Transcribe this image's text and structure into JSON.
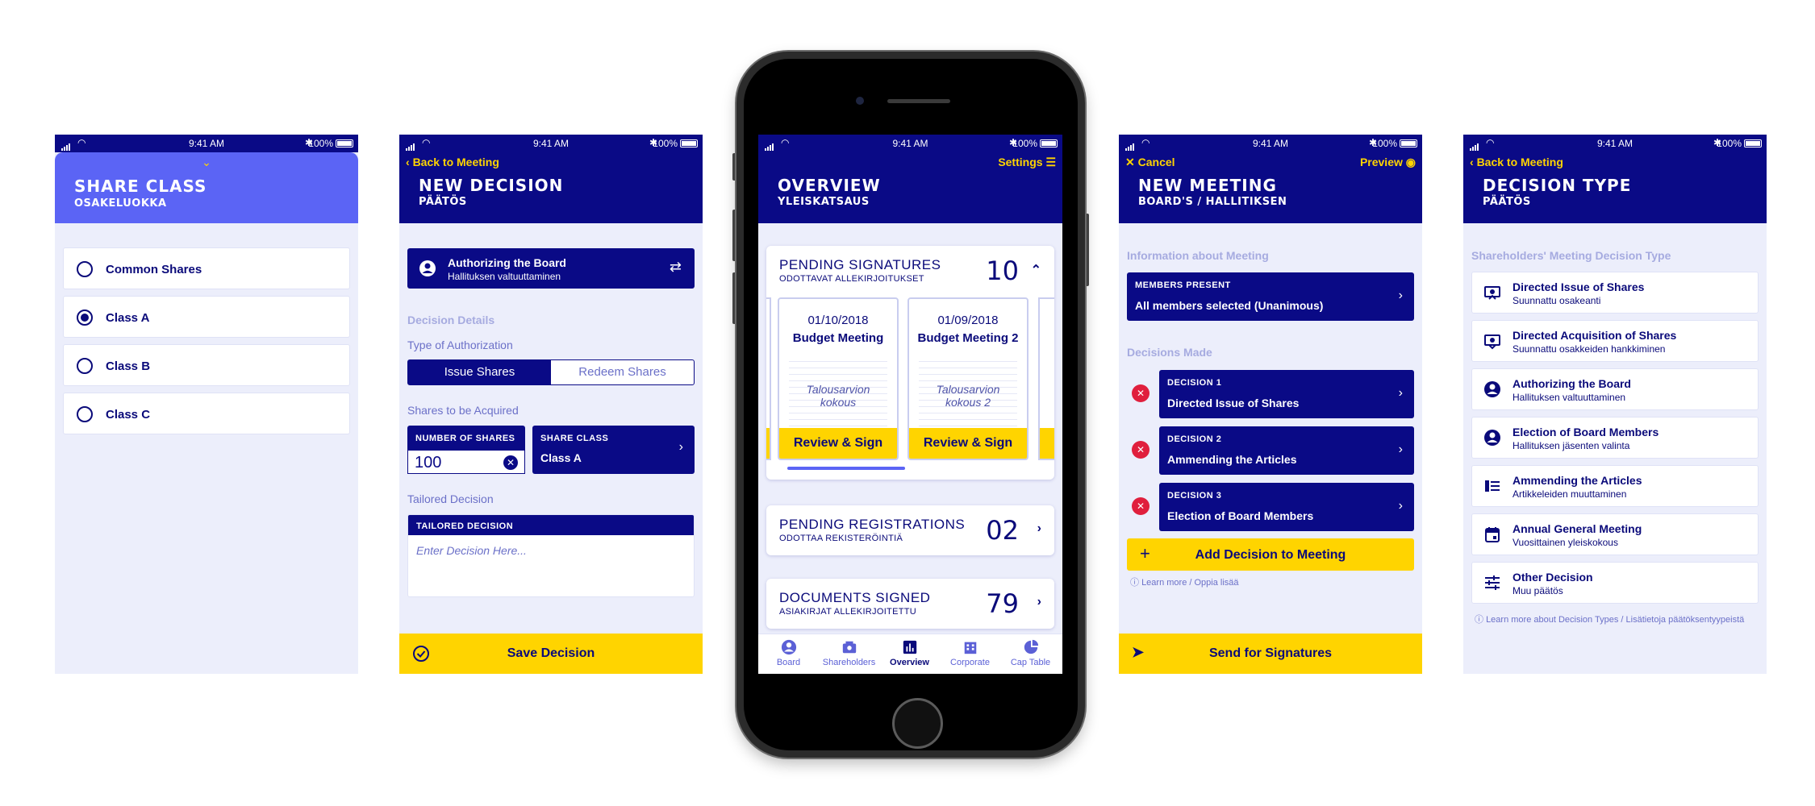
{
  "status": {
    "time": "9:41 AM",
    "battery": "100%"
  },
  "share_class": {
    "title": "SHARE CLASS",
    "subtitle": "OSAKELUOKKA",
    "options": [
      {
        "label": "Common Shares",
        "selected": false
      },
      {
        "label": "Class A",
        "selected": true
      },
      {
        "label": "Class B",
        "selected": false
      },
      {
        "label": "Class C",
        "selected": false
      }
    ]
  },
  "new_decision": {
    "back": "Back to Meeting",
    "title": "NEW DECISION",
    "subtitle": "PÄÄTÖS",
    "auth_title": "Authorizing the Board",
    "auth_sub": "Hallituksen valtuuttaminen",
    "details_label": "Decision Details",
    "type_label": "Type of Authorization",
    "seg_issue": "Issue Shares",
    "seg_redeem": "Redeem Shares",
    "acquired_label": "Shares to be Acquired",
    "num_label": "NUMBER OF SHARES",
    "num_value": "100",
    "class_label": "SHARE CLASS",
    "class_value": "Class A",
    "tailored_label": "Tailored Decision",
    "tailored_box_label": "TAILORED DECISION",
    "tailored_placeholder": "Enter Decision Here...",
    "save": "Save Decision"
  },
  "overview": {
    "settings": "Settings",
    "title": "OVERVIEW",
    "subtitle": "YLEISKATSAUS",
    "pending_sig_title": "PENDING SIGNATURES",
    "pending_sig_sub": "ODOTTAVAT ALLEKIRJOITUKSET",
    "pending_sig_count": "10",
    "meetings": [
      {
        "date": "01/10/2018",
        "name": "Budget Meeting",
        "doc1": "Talousarvion",
        "doc2": "kokous",
        "action": "Review & Sign"
      },
      {
        "date": "01/09/2018",
        "name": "Budget Meeting 2",
        "doc1": "Talousarvion",
        "doc2": "kokous 2",
        "action": "Review & Sign"
      }
    ],
    "pending_reg_title": "PENDING REGISTRATIONS",
    "pending_reg_sub": "ODOTTAA REKISTERÖINTIÄ",
    "pending_reg_count": "02",
    "docs_title": "DOCUMENTS SIGNED",
    "docs_sub": "ASIAKIRJAT ALLEKIRJOITETTU",
    "docs_count": "79",
    "tabs": [
      "Board",
      "Shareholders",
      "Overview",
      "Corporate",
      "Cap Table"
    ]
  },
  "new_meeting": {
    "cancel": "Cancel",
    "preview": "Preview",
    "title": "NEW MEETING",
    "subtitle": "BOARD'S / HALLITIKSEN",
    "info_label": "Information about Meeting",
    "members_label": "MEMBERS PRESENT",
    "members_value": "All members selected (Unanimous)",
    "decisions_label": "Decisions Made",
    "decisions": [
      {
        "label": "DECISION 1",
        "value": "Directed Issue of Shares"
      },
      {
        "label": "DECISION 2",
        "value": "Ammending the Articles"
      },
      {
        "label": "DECISION 3",
        "value": "Election of Board Members"
      }
    ],
    "add": "Add Decision to Meeting",
    "learn": "Learn more / Oppia lisää",
    "send": "Send for Signatures"
  },
  "decision_type": {
    "back": "Back to Meeting",
    "title": "DECISION TYPE",
    "subtitle": "PÄÄTÖS",
    "section": "Shareholders' Meeting Decision Type",
    "items": [
      {
        "title": "Directed Issue of Shares",
        "sub": "Suunnattu osakeanti",
        "icon": "share-issue-icon"
      },
      {
        "title": "Directed Acquisition of Shares",
        "sub": "Suunnattu osakkeiden hankkiminen",
        "icon": "share-acquire-icon"
      },
      {
        "title": "Authorizing the Board",
        "sub": "Hallituksen valtuuttaminen",
        "icon": "person-icon"
      },
      {
        "title": "Election of Board Members",
        "sub": "Hallituksen jäsenten valinta",
        "icon": "person-icon"
      },
      {
        "title": "Ammending the Articles",
        "sub": "Artikkeleiden muuttaminen",
        "icon": "articles-icon"
      },
      {
        "title": "Annual General Meeting",
        "sub": "Vuosittainen yleiskokous",
        "icon": "calendar-icon"
      },
      {
        "title": "Other Decision",
        "sub": "Muu päätös",
        "icon": "sliders-icon"
      }
    ],
    "learn": "Learn more about Decision Types / Lisätietoja päätöksentyypeistä"
  },
  "colors": {
    "navy": "#0a0a86",
    "accent_yellow": "#ffd400",
    "periwinkle": "#5b64f5",
    "background": "#eceefb"
  }
}
